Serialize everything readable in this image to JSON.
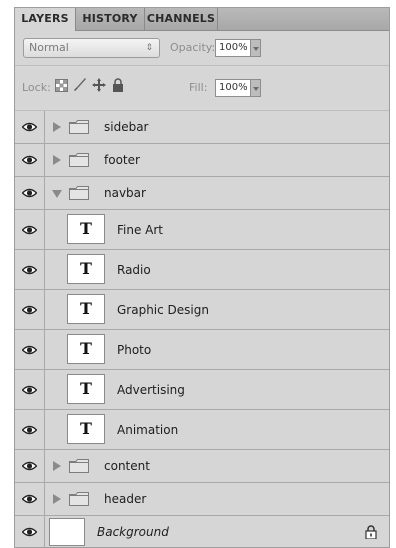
{
  "tabs": [
    {
      "label": "LAYERS",
      "active": true
    },
    {
      "label": "HISTORY",
      "active": false
    },
    {
      "label": "CHANNELS",
      "active": false
    }
  ],
  "blend_mode": "Normal",
  "opacity": {
    "label": "Opacity:",
    "value": "100%"
  },
  "lock": {
    "label": "Lock:"
  },
  "fill": {
    "label": "Fill:",
    "value": "100%"
  },
  "layers": [
    {
      "name": "sidebar",
      "type": "folder",
      "expanded": false
    },
    {
      "name": "footer",
      "type": "folder",
      "expanded": false
    },
    {
      "name": "navbar",
      "type": "folder",
      "expanded": true
    },
    {
      "name": "Fine Art",
      "type": "text"
    },
    {
      "name": "Radio",
      "type": "text"
    },
    {
      "name": "Graphic Design",
      "type": "text"
    },
    {
      "name": "Photo",
      "type": "text"
    },
    {
      "name": "Advertising",
      "type": "text"
    },
    {
      "name": "Animation",
      "type": "text"
    },
    {
      "name": "content",
      "type": "folder",
      "expanded": false
    },
    {
      "name": "header",
      "type": "folder",
      "expanded": false
    },
    {
      "name": "Background",
      "type": "background",
      "locked": true
    }
  ],
  "text_thumb_glyph": "T",
  "icons": {
    "visibility": "eye-icon",
    "folder": "folder-icon",
    "lock_transparent": "checkerboard-lock-icon",
    "lock_image": "brush-lock-icon",
    "lock_position": "move-lock-icon",
    "lock_all": "padlock-icon"
  }
}
